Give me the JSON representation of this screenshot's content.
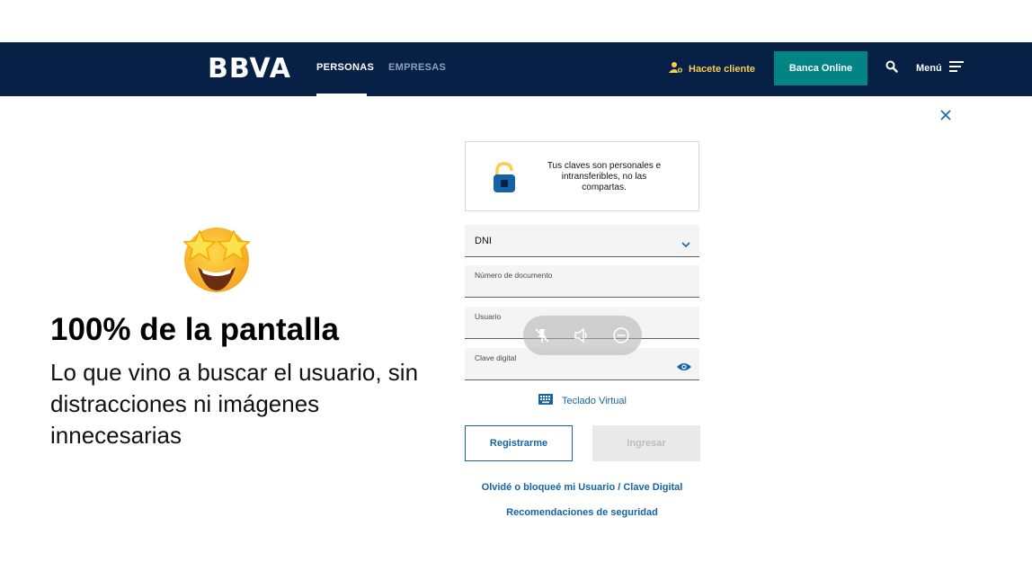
{
  "header": {
    "logo": "BBVA",
    "nav": {
      "personas": "PERSONAS",
      "empresas": "EMPRESAS"
    },
    "hacete_cliente": "Hacete cliente",
    "banca_online": "Banca Online",
    "menu": "Menú"
  },
  "promo": {
    "title": "100% de la pantalla",
    "subtitle": "Lo que vino a buscar el usuario, sin distracciones ni imágenes innecesarias"
  },
  "form": {
    "notice": "Tus claves son personales e intransferibles, no las compartas.",
    "doc_type": "DNI",
    "doc_number_label": "Número de documento",
    "user_label": "Usuario",
    "password_label": "Clave digital",
    "virtual_keyboard": "Teclado Virtual",
    "register": "Registrarme",
    "login": "Ingresar",
    "forgot": "Olvidé o bloqueé mi Usuario / Clave Digital",
    "security": "Recomendaciones de seguridad"
  },
  "colors": {
    "navy": "#072146",
    "teal": "#028484",
    "link_blue": "#1464a5",
    "gold": "#f8cd51"
  }
}
